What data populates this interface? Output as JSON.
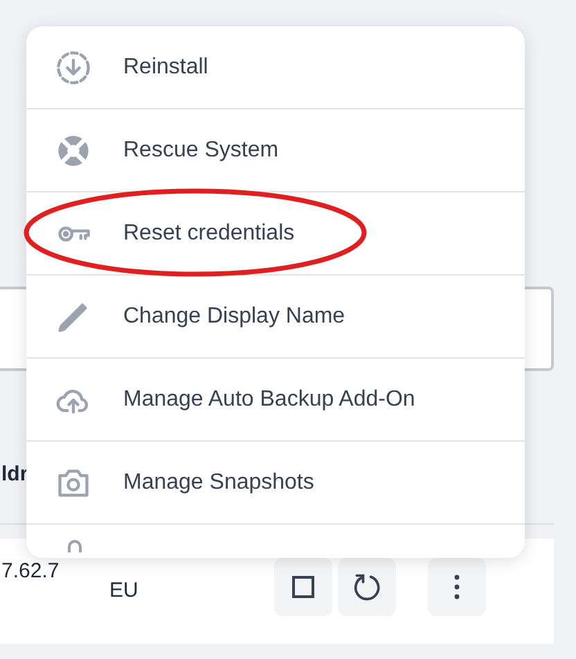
{
  "menu": {
    "items": [
      {
        "label": "Reinstall"
      },
      {
        "label": "Rescue System"
      },
      {
        "label": "Reset credentials"
      },
      {
        "label": "Change Display Name"
      },
      {
        "label": "Manage Auto Backup Add-On"
      },
      {
        "label": "Manage Snapshots"
      }
    ]
  },
  "table": {
    "column_1": "ldr",
    "rows": [
      {
        "column_1": "7.62.7",
        "column_2": "EU"
      }
    ]
  }
}
